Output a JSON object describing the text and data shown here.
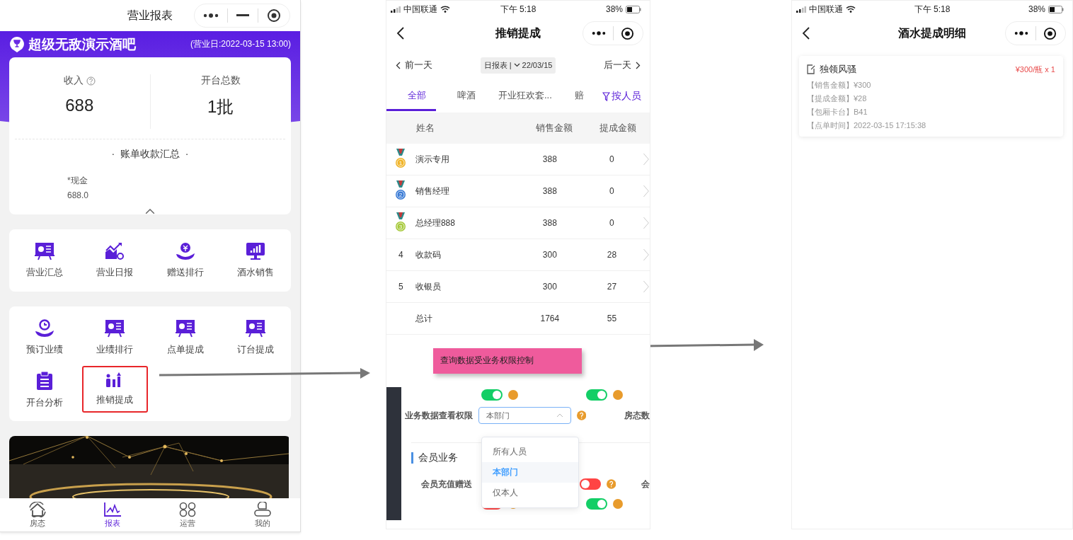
{
  "report_screen": {
    "title": "营业报表",
    "venue": {
      "name": "超级无敌演示酒吧",
      "business_day": "(营业日:2022-03-15 13:00)"
    },
    "stats": [
      {
        "label": "收入",
        "help": true,
        "value": "688"
      },
      {
        "label": "开台总数",
        "help": false,
        "value": "1批"
      }
    ],
    "summary_title": "·  账单收款汇总  ·",
    "payments": [
      {
        "label": "*现金",
        "value": "688.0"
      }
    ],
    "menu_groups": [
      [
        {
          "label": "营业汇总",
          "highlighted": false
        },
        {
          "label": "营业日报",
          "highlighted": false
        },
        {
          "label": "赠送排行",
          "highlighted": false
        },
        {
          "label": "酒水销售",
          "highlighted": false
        }
      ],
      [
        {
          "label": "预订业绩",
          "highlighted": false
        },
        {
          "label": "业绩排行",
          "highlighted": false
        },
        {
          "label": "点单提成",
          "highlighted": false
        },
        {
          "label": "订台提成",
          "highlighted": false
        },
        {
          "label": "开台分析",
          "highlighted": false
        },
        {
          "label": "推销提成",
          "highlighted": true
        }
      ]
    ],
    "tabs": [
      {
        "label": "房态",
        "selected": false
      },
      {
        "label": "报表",
        "selected": true
      },
      {
        "label": "运营",
        "selected": false
      },
      {
        "label": "我的",
        "selected": false
      }
    ]
  },
  "commission_screen": {
    "status_bar": {
      "carrier": "中国联通",
      "time": "下午 5:18",
      "battery": "38%"
    },
    "title": "推销提成",
    "prev_day": "前一天",
    "report_type": "日报表 |",
    "date": "22/03/15",
    "next_day": "后一天",
    "categories": [
      {
        "label": "全部",
        "selected": true
      },
      {
        "label": "啤酒",
        "selected": false
      },
      {
        "label": "开业狂欢套...",
        "selected": false
      },
      {
        "label": "赔",
        "selected": false
      }
    ],
    "filter": "按人员",
    "columns": [
      "姓名",
      "销售金额",
      "提成金额"
    ],
    "rows": [
      {
        "kind": "medal",
        "rank": "1",
        "color": "#f0b429",
        "name": "演示专用",
        "sales": "388",
        "commission": "0"
      },
      {
        "kind": "medal",
        "rank": "2",
        "color": "#3a7bd5",
        "name": "销售经理",
        "sales": "388",
        "commission": "0"
      },
      {
        "kind": "medal",
        "rank": "3",
        "color": "#a6c93a",
        "name": "总经理888",
        "sales": "388",
        "commission": "0"
      },
      {
        "kind": "number",
        "rank": "4",
        "name": "收款码",
        "sales": "300",
        "commission": "28"
      },
      {
        "kind": "number",
        "rank": "5",
        "name": "收银员",
        "sales": "300",
        "commission": "27"
      }
    ],
    "total": {
      "label": "总计",
      "sales": "1764",
      "commission": "55"
    },
    "callout": "查询数据受业务权限控制",
    "permissions": {
      "top_toggles": [
        {
          "on": true
        },
        {
          "on": true
        }
      ],
      "scope_label": "业务数据查看权限",
      "scope_value": "本部门",
      "next_label": "房态数",
      "scope_options": [
        {
          "label": "所有人员",
          "selected": false
        },
        {
          "label": "本部门",
          "selected": true
        },
        {
          "label": "仅本人",
          "selected": false
        }
      ],
      "section": "会员业务",
      "member_label": "会员充值赠送",
      "member_toggle": {
        "on": false
      },
      "member_next": "会",
      "bottom_toggles": [
        {
          "on": false
        },
        {
          "on": true
        }
      ]
    }
  },
  "detail_screen": {
    "status_bar": {
      "carrier": "中国联通",
      "time": "下午 5:18",
      "battery": "38%"
    },
    "title": "酒水提成明细",
    "item": {
      "name": "独领风骚",
      "price": "¥300/瓶 x 1",
      "lines": [
        "【销售金额】¥300",
        "【提成金额】¥28",
        "【包厢卡台】B41",
        "【点单时间】2022-03-15 17:15:38"
      ]
    }
  }
}
